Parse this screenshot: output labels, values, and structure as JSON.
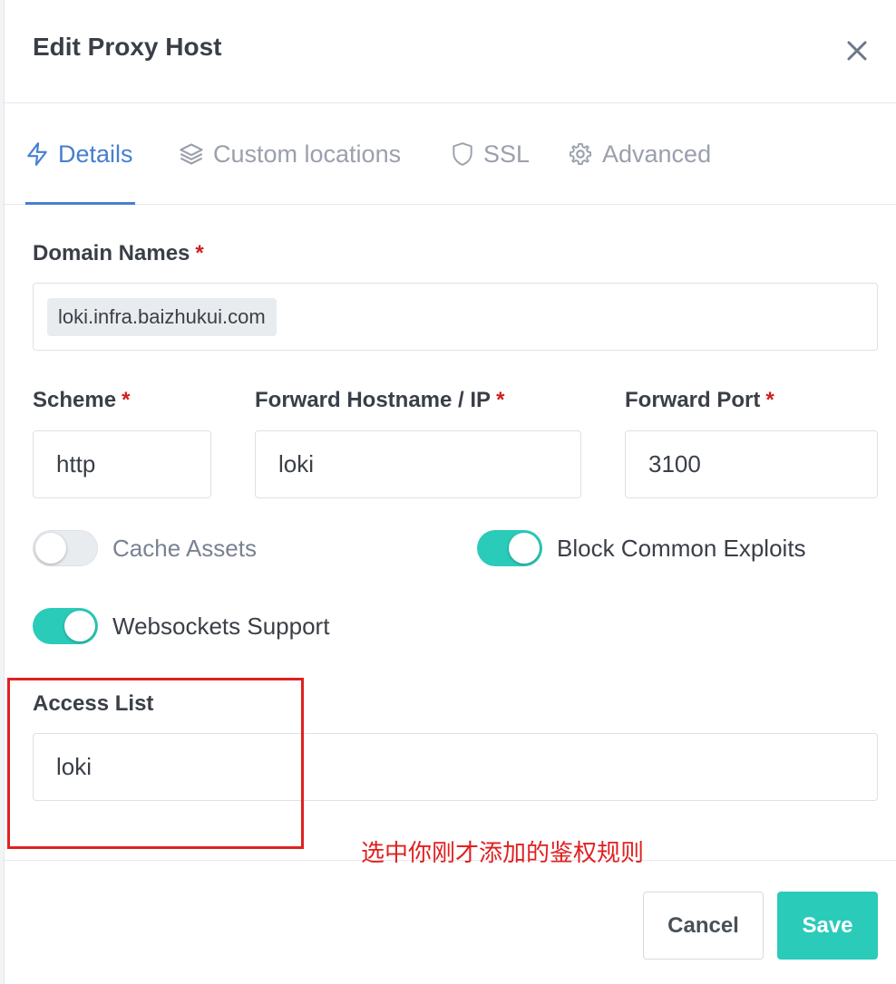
{
  "modal": {
    "title": "Edit Proxy Host",
    "close_icon": "close-icon"
  },
  "tabs": [
    {
      "label": "Details",
      "icon": "lightning-icon",
      "active": true
    },
    {
      "label": "Custom locations",
      "icon": "layers-icon",
      "active": false
    },
    {
      "label": "SSL",
      "icon": "shield-icon",
      "active": false
    },
    {
      "label": "Advanced",
      "icon": "gear-icon",
      "active": false
    }
  ],
  "form": {
    "domain_names": {
      "label": "Domain Names",
      "required_mark": "*",
      "values": [
        "loki.infra.baizhukui.com"
      ]
    },
    "scheme": {
      "label": "Scheme",
      "required_mark": "*",
      "value": "http"
    },
    "forward_host": {
      "label": "Forward Hostname / IP",
      "required_mark": "*",
      "value": "loki"
    },
    "forward_port": {
      "label": "Forward Port",
      "required_mark": "*",
      "value": "3100"
    },
    "cache_assets": {
      "label": "Cache Assets",
      "enabled": false
    },
    "block_exploits": {
      "label": "Block Common Exploits",
      "enabled": true
    },
    "websockets": {
      "label": "Websockets Support",
      "enabled": true
    },
    "access_list": {
      "label": "Access List",
      "value": "loki"
    }
  },
  "annotation": {
    "text": "选中你刚才添加的鉴权规则",
    "color": "#e02020"
  },
  "footer": {
    "cancel_label": "Cancel",
    "save_label": "Save"
  },
  "colors": {
    "accent": "#467fcf",
    "teal": "#2bcbba",
    "required": "#cd201f"
  }
}
